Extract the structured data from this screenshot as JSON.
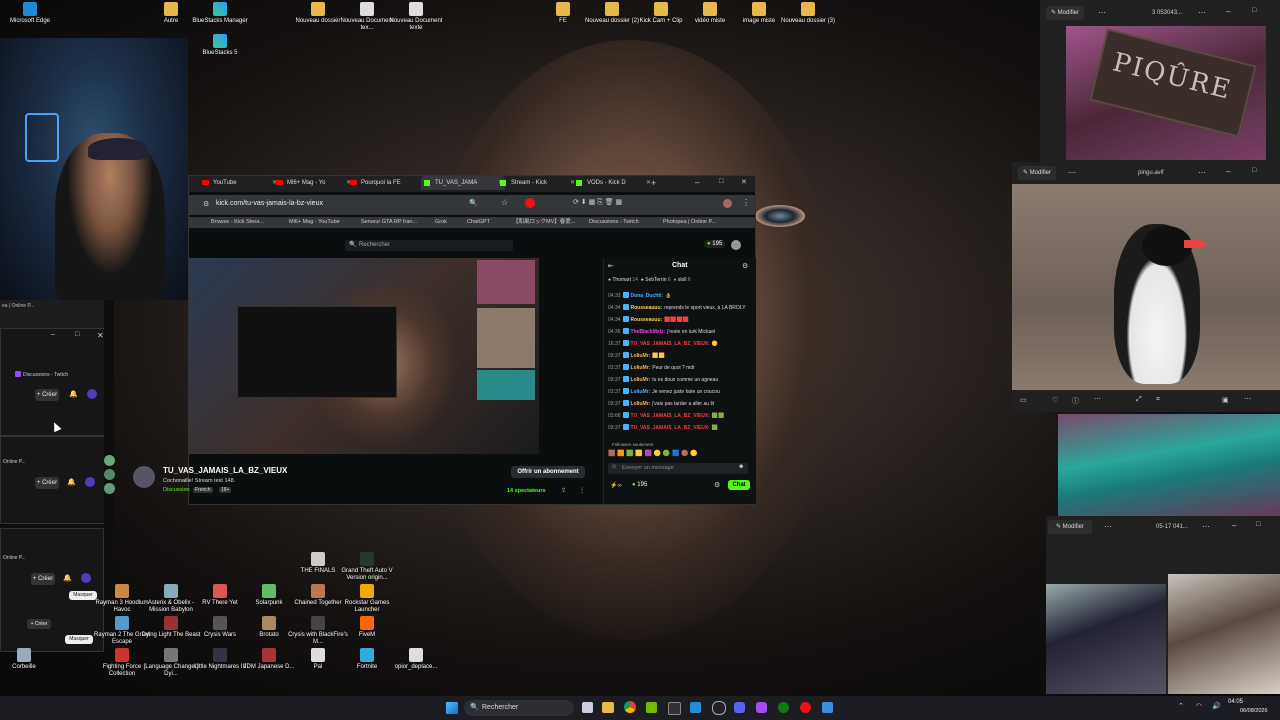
{
  "desktop": {
    "icons_top": [
      {
        "label": "Microsoft Edge"
      },
      {
        "label": "Autre"
      },
      {
        "label": "BlueStacks Manager"
      },
      {
        "label": "Nouveau dossier"
      },
      {
        "label": "Nouveau Document tex..."
      },
      {
        "label": "Nouveau Document texte"
      },
      {
        "label": "FE"
      },
      {
        "label": "Nouveau dossier (2)"
      },
      {
        "label": "Kick Cam + Clip"
      },
      {
        "label": "vidéo miste"
      },
      {
        "label": "image miste"
      },
      {
        "label": "Nouveau dossier (3)"
      }
    ],
    "bluestacks5": "BlueStacks 5",
    "icons_bottom": [
      {
        "label": "THE FINALS"
      },
      {
        "label": "Grand Theft Auto V Version origin..."
      },
      {
        "label": "Rayman 3 Hoodlum Havoc"
      },
      {
        "label": "Asterix & Obelix - Mission Babylon"
      },
      {
        "label": "RV There Yet"
      },
      {
        "label": "Solarpunk"
      },
      {
        "label": "Chained Together"
      },
      {
        "label": "Rockstar Games Launcher"
      },
      {
        "label": "Rayman 2 The Great Escape"
      },
      {
        "label": "Dying Light The Beast"
      },
      {
        "label": "Crysis Wars"
      },
      {
        "label": "Brotato"
      },
      {
        "label": "Crysis with BlackFire's M..."
      },
      {
        "label": "FiveM"
      },
      {
        "label": "Fighting Force Collection"
      },
      {
        "label": "[Language Changer] Dyi..."
      },
      {
        "label": "Little Nightmares III"
      },
      {
        "label": "JDM Japanese D..."
      },
      {
        "label": "Pal"
      },
      {
        "label": "Fortnite"
      },
      {
        "label": "opior_deplace..."
      }
    ],
    "corbeille": "Corbeille"
  },
  "browser": {
    "tabs": [
      {
        "label": "YouTube"
      },
      {
        "label": "Mi6+ Mag - Yo"
      },
      {
        "label": "Pourquoi la FE"
      },
      {
        "label": "TU_VAS_JAMA"
      },
      {
        "label": "Stream - Kick"
      },
      {
        "label": "VODs - Kick D"
      }
    ],
    "url": "kick.com/tu-vas-jamais-la-bz-vieux",
    "bookmarks": [
      {
        "label": "Browse - Kick Strea..."
      },
      {
        "label": "Mi6+ Mag - YouTube"
      },
      {
        "label": "Serveur GTA RP fran..."
      },
      {
        "label": "Grok"
      },
      {
        "label": "ChatGPT"
      },
      {
        "label": "【和風ロックMV】春愛..."
      },
      {
        "label": "Discussions - Twitch"
      },
      {
        "label": "Photopea | Online P..."
      }
    ],
    "search_placeholder": "Rechercher",
    "credits": "195",
    "channel": {
      "name": "TU_VAS_JAMAIS_LA_BZ_VIEUX",
      "title": "Cochonaille! Stream test 148.",
      "tags": [
        "Discussion",
        "French",
        "18+"
      ],
      "subscribe": "Offrir un abonnement",
      "viewers": "14 spectateurs"
    },
    "chat": {
      "title": "Chat",
      "top_supporters": [
        "Thomart",
        "SebTerrin",
        "sloll"
      ],
      "top_counts": [
        "14",
        "6",
        "6"
      ],
      "messages": [
        {
          "time": "04:33",
          "user": "Dona_Duchti:",
          "text": "👌",
          "color": "#4ab3ff"
        },
        {
          "time": "04:34",
          "user": "Rousseauuu:",
          "text": "reprends le sport vieux, à LA BROLY",
          "color": "#ffd34d"
        },
        {
          "time": "04:34",
          "user": "Rousseauuu:",
          "text": "🟥🟥🟥🟥",
          "color": "#ffd34d"
        },
        {
          "time": "04:36",
          "user": "TheBlackMelz:",
          "text": "j'reste en lurk Mickael",
          "color": "#e94bd8"
        },
        {
          "time": "16:37",
          "user": "TU_VAS_JAMAIS_LA_BZ_VIEUX:",
          "text": "🟡",
          "color": "#ff3b3b"
        },
        {
          "time": "03:37",
          "user": "LoliuMr:",
          "text": "🟨🟨",
          "color": "#ffb84d"
        },
        {
          "time": "03:37",
          "user": "LoliuMr:",
          "text": "Peur de quoi ? mdr",
          "color": "#ffb84d"
        },
        {
          "time": "03:37",
          "user": "LoliuMr:",
          "text": "tu es doux comme un agneau",
          "color": "#ffb84d"
        },
        {
          "time": "03:37",
          "user": "LoliuMr:",
          "text": "Je venez juste faire un coucou",
          "color": "#4ab3ff"
        },
        {
          "time": "03:37",
          "user": "LoliuMr:",
          "text": "j'vais pas tarder a aller au lit",
          "color": "#ffb84d"
        },
        {
          "time": "03:68",
          "user": "TU_VAS_JAMAIS_LA_BZ_VIEUX:",
          "text": "🟩🟩",
          "color": "#ff3b3b"
        },
        {
          "time": "03:37",
          "user": "TU_VAS_JAMAIS_LA_BZ_VIEUX:",
          "text": "🟩",
          "color": "#ff3b3b"
        }
      ],
      "followers_only": "Followers seulement",
      "input_placeholder": "Envoyer un message",
      "points": "195",
      "send": "Chat"
    }
  },
  "side_windows": {
    "items": [
      {
        "label": "Discussions - Twitch"
      },
      {
        "label": "Créer"
      },
      {
        "label": "Online P..."
      },
      {
        "label": "Créer"
      },
      {
        "label": "Online P..."
      },
      {
        "label": "Créer"
      },
      {
        "label": "Créer"
      },
      {
        "label": "Masquer"
      },
      {
        "label": "Masquer"
      }
    ],
    "photopea": "ea | Online P..."
  },
  "photos": {
    "modifier": "Modifier",
    "w1_title": "3 053043...",
    "w2_title": "pingu.avif",
    "w3_title": "05-17 041...",
    "sign_text": "PIQÛRE"
  },
  "taskbar": {
    "search": "Rechercher",
    "time": "04:05",
    "date": "06/08/2026"
  }
}
